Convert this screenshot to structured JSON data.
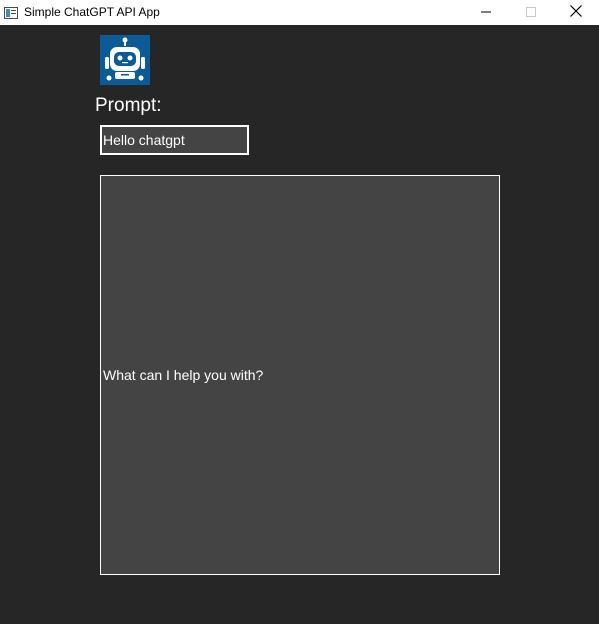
{
  "window": {
    "title": "Simple ChatGPT API App",
    "controls": {
      "minimize_icon": "minimize-icon",
      "maximize_icon": "maximize-icon",
      "close_icon": "close-icon"
    }
  },
  "main": {
    "logo_icon": "robot-icon",
    "prompt_label": "Prompt:",
    "prompt_input": {
      "value": "Hello chatgpt",
      "placeholder": ""
    },
    "response_text": "What can I help you with?"
  },
  "colors": {
    "background": "#262626",
    "panel": "#444444",
    "text": "#ffffff",
    "logo_background": "#0b5b97"
  }
}
